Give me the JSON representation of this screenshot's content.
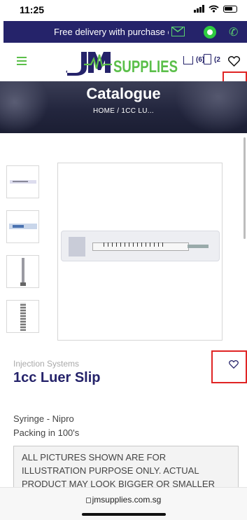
{
  "status_bar": {
    "time": "11:25"
  },
  "promo": {
    "text": "Free delivery with purchase o",
    "icons": [
      "mail-icon",
      "whatsapp-icon",
      "phone-icon"
    ]
  },
  "header": {
    "logo_text": "SUPPLIES",
    "logo_monogram": "JM",
    "cart_count": "(6)",
    "quote_count": "(2",
    "icons": [
      "menu-icon",
      "cart-icon",
      "document-icon",
      "heart-icon"
    ]
  },
  "banner": {
    "title": "Catalogue",
    "breadcrumb": "HOME  /  1CC LU..."
  },
  "product": {
    "category": "Injection Systems",
    "name": "1cc Luer Slip",
    "line1": "Syringe - Nipro",
    "line2": "Packing in 100's",
    "notice": "ALL PICTURES SHOWN ARE FOR ILLUSTRATION PURPOSE ONLY. ACTUAL PRODUCT MAY LOOK BIGGER OR SMALLER"
  },
  "browser": {
    "url": "jmsupplies.com.sg"
  },
  "colors": {
    "brand_navy": "#25236a",
    "accent_green": "#5bbf4a",
    "highlight_red": "#e02424"
  }
}
